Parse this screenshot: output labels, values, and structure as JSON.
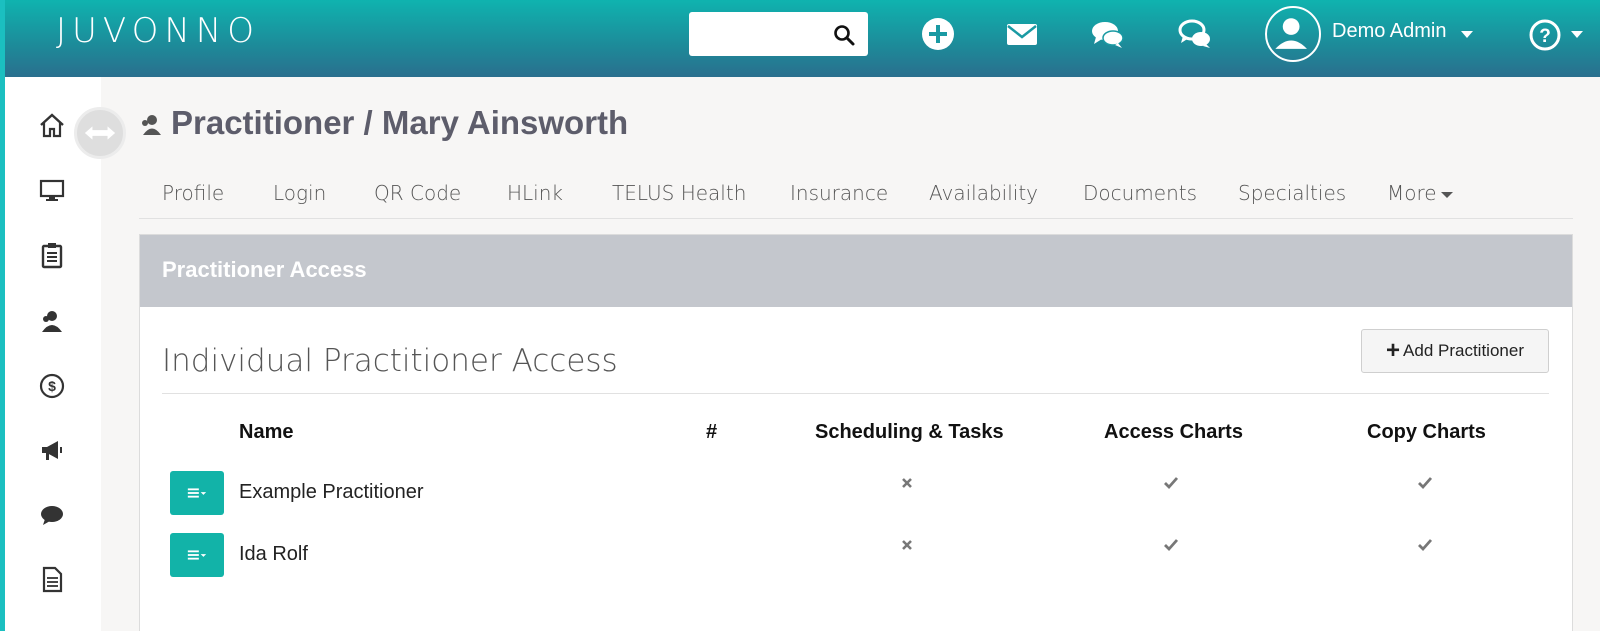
{
  "app": {
    "logo": "JUVONNO"
  },
  "search": {
    "placeholder": "",
    "value": ""
  },
  "user": {
    "name": "Demo Admin"
  },
  "colors": {
    "accent": "#12b3a8",
    "header_top": "#0fb3af",
    "header_bottom": "#2a6f8e",
    "panel_header": "#c4c7cd"
  },
  "top_icons": [
    "plus-circle-icon",
    "envelope-icon",
    "chat-bubbles-icon",
    "support-chat-icon",
    "user-icon",
    "help-icon"
  ],
  "sidebar": {
    "icons": [
      "home-icon",
      "monitor-icon",
      "clipboard-icon",
      "users-icon",
      "dollar-icon",
      "megaphone-icon",
      "chat-icon",
      "document-icon"
    ]
  },
  "page": {
    "title": "Practitioner / Mary Ainsworth"
  },
  "tabs": [
    "Profile",
    "Login",
    "QR Code",
    "HLink",
    "TELUS Health",
    "Insurance",
    "Availability",
    "Documents",
    "Specialties",
    "More"
  ],
  "panel": {
    "header": "Practitioner Access",
    "section_title": "Individual Practitioner Access",
    "add_button": "Add Practitioner"
  },
  "table": {
    "columns": [
      "Name",
      "#",
      "Scheduling & Tasks",
      "Access Charts",
      "Copy Charts"
    ],
    "rows": [
      {
        "name": "Example Practitioner",
        "scheduling": false,
        "access_charts": true,
        "copy_charts": true
      },
      {
        "name": "Ida Rolf",
        "scheduling": false,
        "access_charts": true,
        "copy_charts": true
      }
    ]
  }
}
